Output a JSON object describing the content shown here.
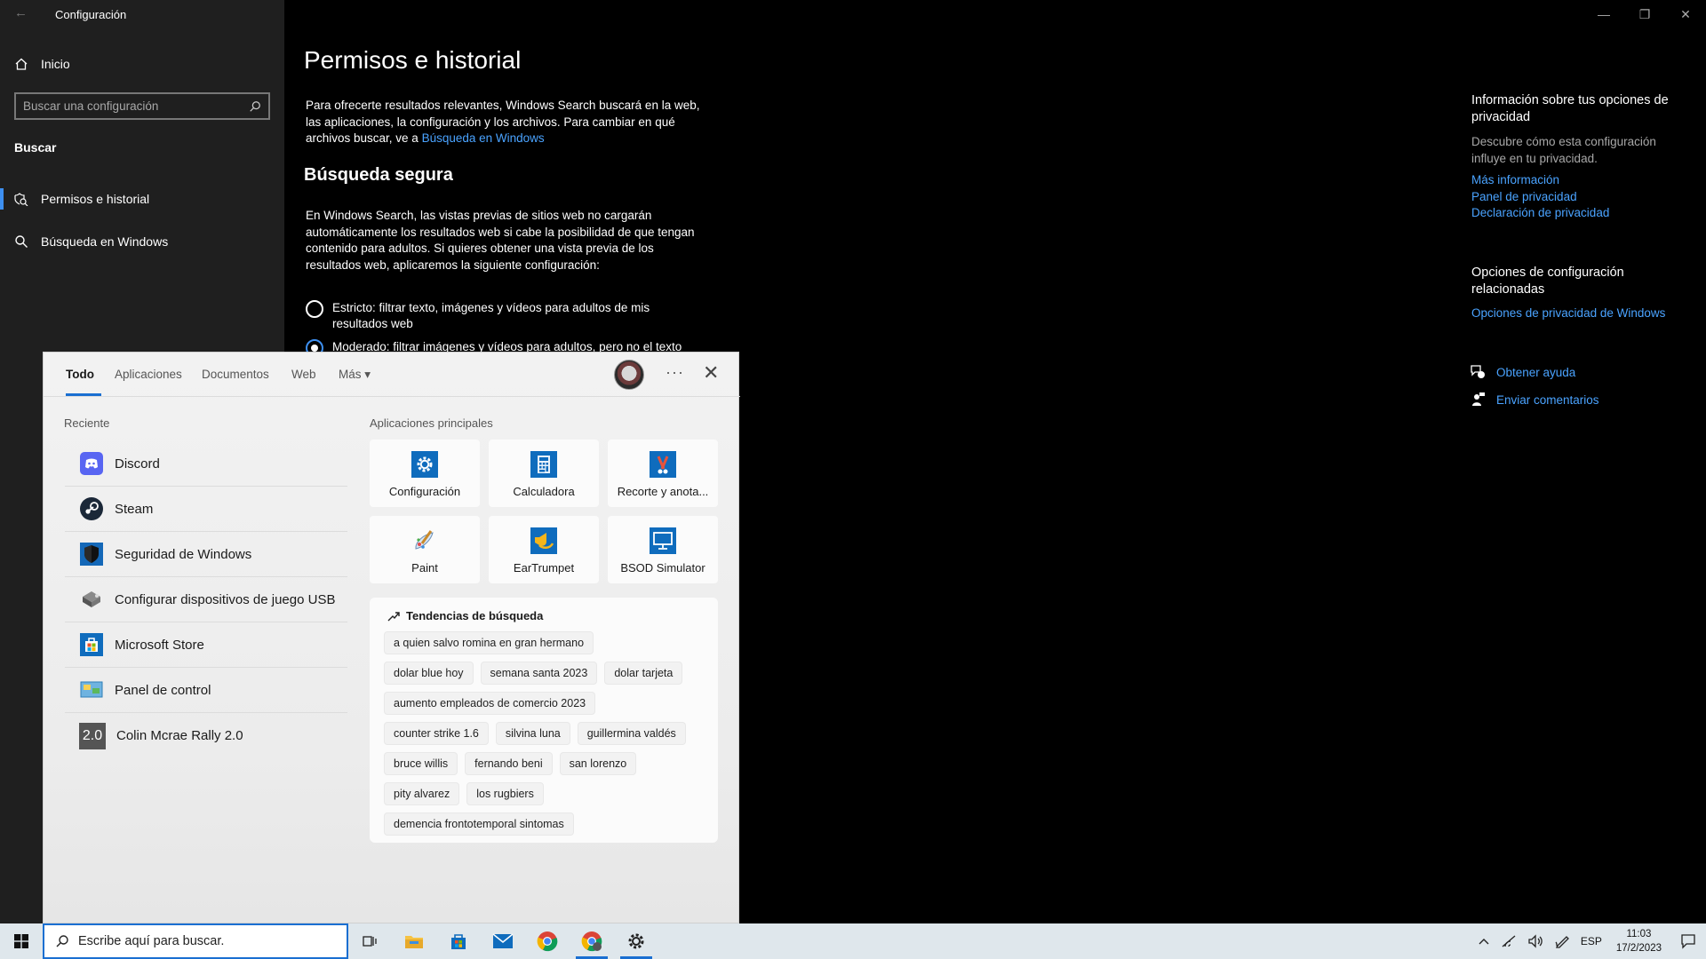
{
  "window": {
    "title": "Configuración",
    "back_glyph": "←",
    "controls": {
      "minimize": "—",
      "restore": "❐",
      "close": "✕"
    }
  },
  "sidebar": {
    "home_label": "Inicio",
    "search_placeholder": "Buscar una configuración",
    "section": "Buscar",
    "items": [
      {
        "label": "Permisos e historial",
        "icon": "shield-search-icon",
        "active": true
      },
      {
        "label": "Búsqueda en Windows",
        "icon": "search-icon",
        "active": false
      }
    ]
  },
  "main": {
    "title": "Permisos e historial",
    "intro_text": "Para ofrecerte resultados relevantes, Windows Search buscará en la web, las aplicaciones, la configuración y los archivos. Para cambiar en qué archivos buscar, ve a ",
    "intro_link": "Búsqueda en Windows",
    "safe_search_title": "Búsqueda segura",
    "safe_search_text": "En Windows Search, las vistas previas de sitios web no cargarán automáticamente los resultados web si cabe la posibilidad de que tengan contenido para adultos. Si quieres obtener una vista previa de los resultados web, aplicaremos la siguiente configuración:",
    "options": [
      {
        "label": "Estricto: filtrar texto, imágenes y vídeos para adultos de mis resultados web",
        "selected": false
      },
      {
        "label": "Moderado: filtrar imágenes y vídeos para adultos, pero no el texto",
        "selected": true
      }
    ]
  },
  "right_panel": {
    "privacy_title": "Información sobre tus opciones de privacidad",
    "privacy_desc": "Descubre cómo esta configuración influye en tu privacidad.",
    "links": [
      "Más información",
      "Panel de privacidad",
      "Declaración de privacidad"
    ],
    "related_title": "Opciones de configuración relacionadas",
    "related_link": "Opciones de privacidad de Windows",
    "help": "Obtener ayuda",
    "feedback": "Enviar comentarios"
  },
  "flyout": {
    "tabs": [
      "Todo",
      "Aplicaciones",
      "Documentos",
      "Web",
      "Más"
    ],
    "more_caret": "▾",
    "menu_glyph": "···",
    "close_glyph": "✕",
    "recent_label": "Reciente",
    "recent": [
      {
        "name": "Discord",
        "icon": "discord-icon"
      },
      {
        "name": "Steam",
        "icon": "steam-icon"
      },
      {
        "name": "Seguridad de Windows",
        "icon": "windows-security-shield-icon"
      },
      {
        "name": "Configurar dispositivos de juego USB",
        "icon": "usb-gamepad-icon"
      },
      {
        "name": "Microsoft Store",
        "icon": "store-bag-icon"
      },
      {
        "name": "Panel de control",
        "icon": "control-panel-icon"
      },
      {
        "name": "Colin Mcrae Rally 2.0",
        "icon": "rally-2-icon",
        "badge": "2.0"
      }
    ],
    "top_apps_label": "Aplicaciones principales",
    "top_apps": [
      {
        "name": "Configuración",
        "icon": "gear-icon"
      },
      {
        "name": "Calculadora",
        "icon": "calculator-icon"
      },
      {
        "name": "Recorte y anota...",
        "icon": "snip-icon"
      },
      {
        "name": "Paint",
        "icon": "paint-icon"
      },
      {
        "name": "EarTrumpet",
        "icon": "eartrumpet-icon"
      },
      {
        "name": "BSOD Simulator",
        "icon": "monitor-icon"
      }
    ],
    "trends_label": "Tendencias de búsqueda",
    "trend_rows": [
      [
        "a quien salvo romina en gran hermano"
      ],
      [
        "dolar blue hoy",
        "semana santa 2023",
        "dolar tarjeta"
      ],
      [
        "aumento empleados de comercio 2023"
      ],
      [
        "counter strike 1.6",
        "silvina luna",
        "guillermina valdés"
      ],
      [
        "bruce willis",
        "fernando beni",
        "san lorenzo"
      ],
      [
        "pity alvarez",
        "los rugbiers"
      ],
      [
        "demencia frontotemporal sintomas"
      ]
    ]
  },
  "taskbar": {
    "search_placeholder": "Escribe aquí para buscar.",
    "language": "ESP",
    "time": "11:03",
    "date": "17/2/2023"
  },
  "colors": {
    "accent": "#3d8ff0",
    "link": "#4aa3ff",
    "sidebar_bg": "#1f1f1f",
    "taskbar_bg": "#dfe7ec"
  }
}
